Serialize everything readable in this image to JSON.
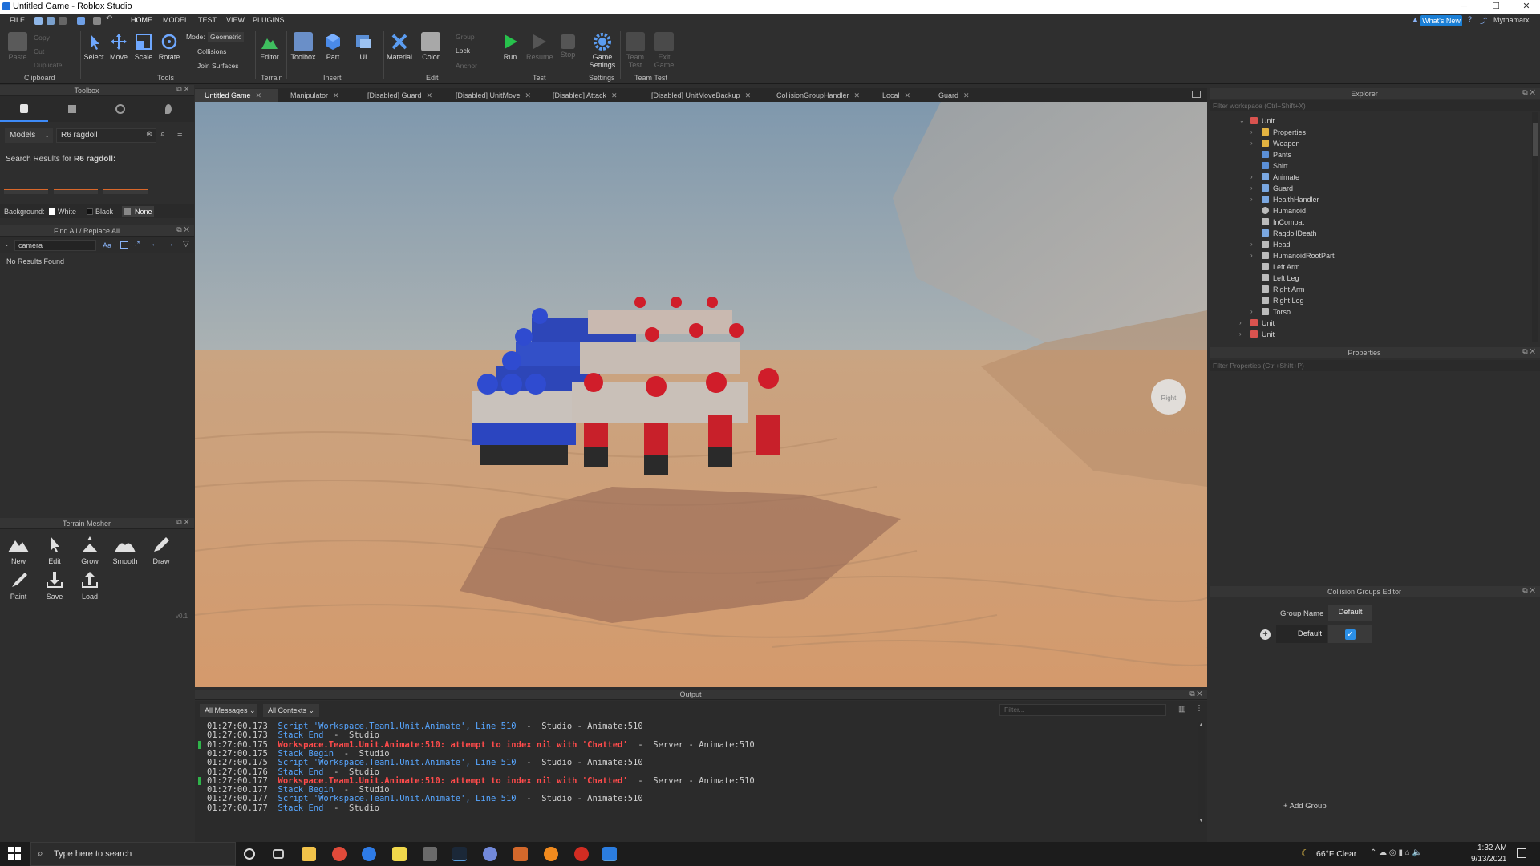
{
  "window": {
    "title": "Untitled Game - Roblox Studio",
    "minimize": "─",
    "maximize": "☐",
    "close": "✕"
  },
  "menu": {
    "items": [
      "FILE",
      "HOME",
      "MODEL",
      "TEST",
      "VIEW",
      "PLUGINS"
    ],
    "whats_new": "What's New",
    "user": "Mythamarx"
  },
  "ribbon": {
    "clipboard": {
      "paste": "Paste",
      "copy": "Copy",
      "cut": "Cut",
      "duplicate": "Duplicate",
      "label": "Clipboard"
    },
    "tools": {
      "select": "Select",
      "move": "Move",
      "scale": "Scale",
      "rotate": "Rotate",
      "mode_label": "Mode:",
      "mode_value": "Geometric",
      "collisions": "Collisions",
      "join_surfaces": "Join Surfaces",
      "label": "Tools"
    },
    "terrain": {
      "editor": "Editor",
      "label": "Terrain"
    },
    "insert": {
      "toolbox": "Toolbox",
      "part": "Part",
      "ui": "UI",
      "label": "Insert"
    },
    "edit": {
      "material": "Material",
      "color": "Color",
      "group": "Group",
      "lock": "Lock",
      "anchor": "Anchor",
      "label": "Edit"
    },
    "test": {
      "run": "Run",
      "resume": "Resume",
      "stop": "Stop",
      "label": "Test"
    },
    "settings": {
      "game_settings": "Game Settings",
      "label": "Settings"
    },
    "team_test": {
      "team_test": "Team Test",
      "exit_game": "Exit Game",
      "label": "Team Test"
    }
  },
  "toolbox": {
    "title": "Toolbox",
    "category": "Models",
    "search_value": "R6 ragdoll",
    "results_prefix": "Search Results for",
    "results_query": "R6 ragdoll:",
    "background_label": "Background:",
    "bg_options": [
      "White",
      "Black",
      "None"
    ]
  },
  "find_replace": {
    "title": "Find All / Replace All",
    "query": "camera",
    "match_case": "Aa",
    "no_results": "No Results Found"
  },
  "terrain_mesher": {
    "title": "Terrain Mesher",
    "tools": [
      "New",
      "Edit",
      "Grow",
      "Smooth",
      "Draw",
      "Paint",
      "Save",
      "Load"
    ],
    "version": "v0.1"
  },
  "tabs": [
    "Untitled Game",
    "Manipulator",
    "[Disabled] Guard",
    "[Disabled] UnitMove",
    "[Disabled] Attack",
    "[Disabled] UnitMoveBackup",
    "CollisionGroupHandler",
    "Local",
    "Guard"
  ],
  "viewport": {
    "view_cube_label": "Right"
  },
  "explorer": {
    "title": "Explorer",
    "filter_placeholder": "Filter workspace (Ctrl+Shift+X)",
    "tree": [
      {
        "label": "Unit",
        "icon_color": "#d9534f"
      },
      {
        "label": "Properties",
        "icon_color": "#e3b341"
      },
      {
        "label": "Weapon",
        "icon_color": "#e3b341"
      },
      {
        "label": "Pants",
        "icon_color": "#5b8fd6"
      },
      {
        "label": "Shirt",
        "icon_color": "#5b8fd6"
      },
      {
        "label": "Animate",
        "icon_color": "#7aa7e0"
      },
      {
        "label": "Guard",
        "icon_color": "#7aa7e0"
      },
      {
        "label": "HealthHandler",
        "icon_color": "#7aa7e0"
      },
      {
        "label": "Humanoid",
        "icon_color": "#bbbbbb"
      },
      {
        "label": "InCombat",
        "icon_color": "#bbbbbb"
      },
      {
        "label": "RagdollDeath",
        "icon_color": "#7aa7e0"
      },
      {
        "label": "Head",
        "icon_color": "#bbbbbb"
      },
      {
        "label": "HumanoidRootPart",
        "icon_color": "#bbbbbb"
      },
      {
        "label": "Left Arm",
        "icon_color": "#bbbbbb"
      },
      {
        "label": "Left Leg",
        "icon_color": "#bbbbbb"
      },
      {
        "label": "Right Arm",
        "icon_color": "#bbbbbb"
      },
      {
        "label": "Right Leg",
        "icon_color": "#bbbbbb"
      },
      {
        "label": "Torso",
        "icon_color": "#bbbbbb"
      },
      {
        "label": "Unit",
        "icon_color": "#d9534f"
      },
      {
        "label": "Unit",
        "icon_color": "#d9534f"
      }
    ]
  },
  "properties": {
    "title": "Properties",
    "filter_placeholder": "Filter Properties (Ctrl+Shift+P)"
  },
  "collision_groups": {
    "title": "Collision Groups Editor",
    "col_header": "Group Name",
    "default_col": "Default",
    "row_name": "Default",
    "add_group": "+ Add Group"
  },
  "output": {
    "title": "Output",
    "filter_messages": "All Messages",
    "filter_contexts": "All Contexts",
    "filter_placeholder": "Filter...",
    "lines": [
      {
        "ts": "01:27:00.173",
        "msg": "Script 'Workspace.Team1.Unit.Animate', Line 510",
        "ctx": "  -  Studio - Animate:510",
        "kind": "info"
      },
      {
        "ts": "01:27:00.173",
        "msg": "Stack End",
        "ctx": "  -  Studio",
        "kind": "info"
      },
      {
        "ts": "01:27:00.175",
        "msg": "Workspace.Team1.Unit.Animate:510: attempt to index nil with 'Chatted'",
        "ctx": "  -  Server - Animate:510",
        "kind": "err"
      },
      {
        "ts": "01:27:00.175",
        "msg": "Stack Begin",
        "ctx": "  -  Studio",
        "kind": "info"
      },
      {
        "ts": "01:27:00.175",
        "msg": "Script 'Workspace.Team1.Unit.Animate', Line 510",
        "ctx": "  -  Studio - Animate:510",
        "kind": "info"
      },
      {
        "ts": "01:27:00.176",
        "msg": "Stack End",
        "ctx": "  -  Studio",
        "kind": "info"
      },
      {
        "ts": "01:27:00.177",
        "msg": "Workspace.Team1.Unit.Animate:510: attempt to index nil with 'Chatted'",
        "ctx": "  -  Server - Animate:510",
        "kind": "err"
      },
      {
        "ts": "01:27:00.177",
        "msg": "Stack Begin",
        "ctx": "  -  Studio",
        "kind": "info"
      },
      {
        "ts": "01:27:00.177",
        "msg": "Script 'Workspace.Team1.Unit.Animate', Line 510",
        "ctx": "  -  Studio - Animate:510",
        "kind": "info"
      },
      {
        "ts": "01:27:00.177",
        "msg": "Stack End",
        "ctx": "  -  Studio",
        "kind": "info"
      }
    ]
  },
  "taskbar": {
    "search_placeholder": "Type here to search",
    "weather": "66°F  Clear",
    "time": "1:32 AM",
    "date": "9/13/2021"
  }
}
